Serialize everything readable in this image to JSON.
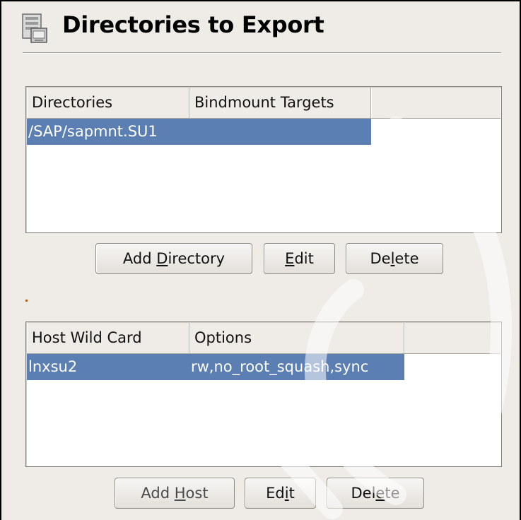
{
  "header": {
    "title": "Directories to Export",
    "icon": "disk-export-icon"
  },
  "directories_table": {
    "columns": [
      "Directories",
      "Bindmount Targets",
      ""
    ],
    "rows": [
      {
        "directory": "/SAP/sapmnt.SU1",
        "bindmount_target": "",
        "selected": true
      }
    ]
  },
  "directory_buttons": {
    "add_prefix": "Add ",
    "add_mnemonic": "D",
    "add_suffix": "irectory",
    "edit_prefix": "",
    "edit_mnemonic": "E",
    "edit_suffix": "dit",
    "delete_prefix": "De",
    "delete_mnemonic": "l",
    "delete_suffix": "ete"
  },
  "hosts_table": {
    "columns": [
      "Host Wild Card",
      "Options",
      ""
    ],
    "rows": [
      {
        "host": "lnxsu2",
        "options": "rw,no_root_squash,sync",
        "selected": true
      }
    ]
  },
  "host_buttons": {
    "add_prefix": "Add ",
    "add_mnemonic": "H",
    "add_suffix": "ost",
    "edit_prefix": "Ed",
    "edit_mnemonic": "i",
    "edit_suffix": "t",
    "delete_prefix": "Del",
    "delete_mnemonic": "e",
    "delete_suffix": "te"
  },
  "colors": {
    "selection": "#5b7fb3",
    "panel": "#efebe7"
  }
}
